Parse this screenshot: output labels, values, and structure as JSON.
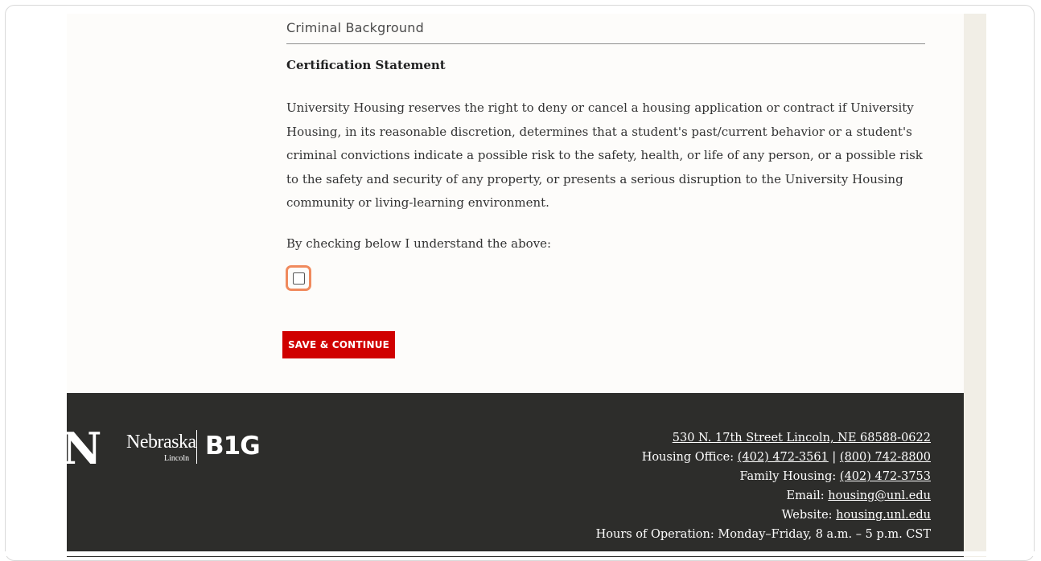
{
  "form": {
    "section_label": "Criminal Background",
    "certification_heading": "Certification Statement",
    "certification_body": "University Housing reserves the right to deny or cancel a housing application or contract if University Housing, in its reasonable discretion, determines that a student's past/current behavior or a student's criminal convictions indicate a possible risk to the safety, health, or life of any person, or a possible risk to the safety and security of any property, or presents a serious disruption to the University Housing community or living-learning environment.",
    "checkbox_prompt": "By checking below I understand the above:",
    "checkbox_checked": false,
    "save_label": "SAVE & CONTINUE"
  },
  "footer": {
    "logo_n": "N",
    "logo_nebraska": "Nebraska",
    "logo_lincoln": "Lincoln",
    "logo_big": "B1G",
    "address": "530 N. 17th Street Lincoln, NE 68588-0622",
    "housing_office_label": "Housing Office:",
    "housing_office_phone1": "(402) 472-3561",
    "phone_separator": "|",
    "housing_office_phone2": "(800) 742-8800",
    "family_housing_label": "Family Housing:",
    "family_housing_phone": "(402) 472-3753",
    "email_label": "Email:",
    "email": "housing@unl.edu",
    "website_label": "Website:",
    "website": "housing.unl.edu",
    "hours": "Hours of Operation: Monday–Friday, 8 a.m. – 5 p.m. CST"
  },
  "colors": {
    "accent_red": "#d00000",
    "footer_bg": "#2d2d2b",
    "highlight_orange": "#f08a5d",
    "page_bg": "#fdfcfa"
  }
}
